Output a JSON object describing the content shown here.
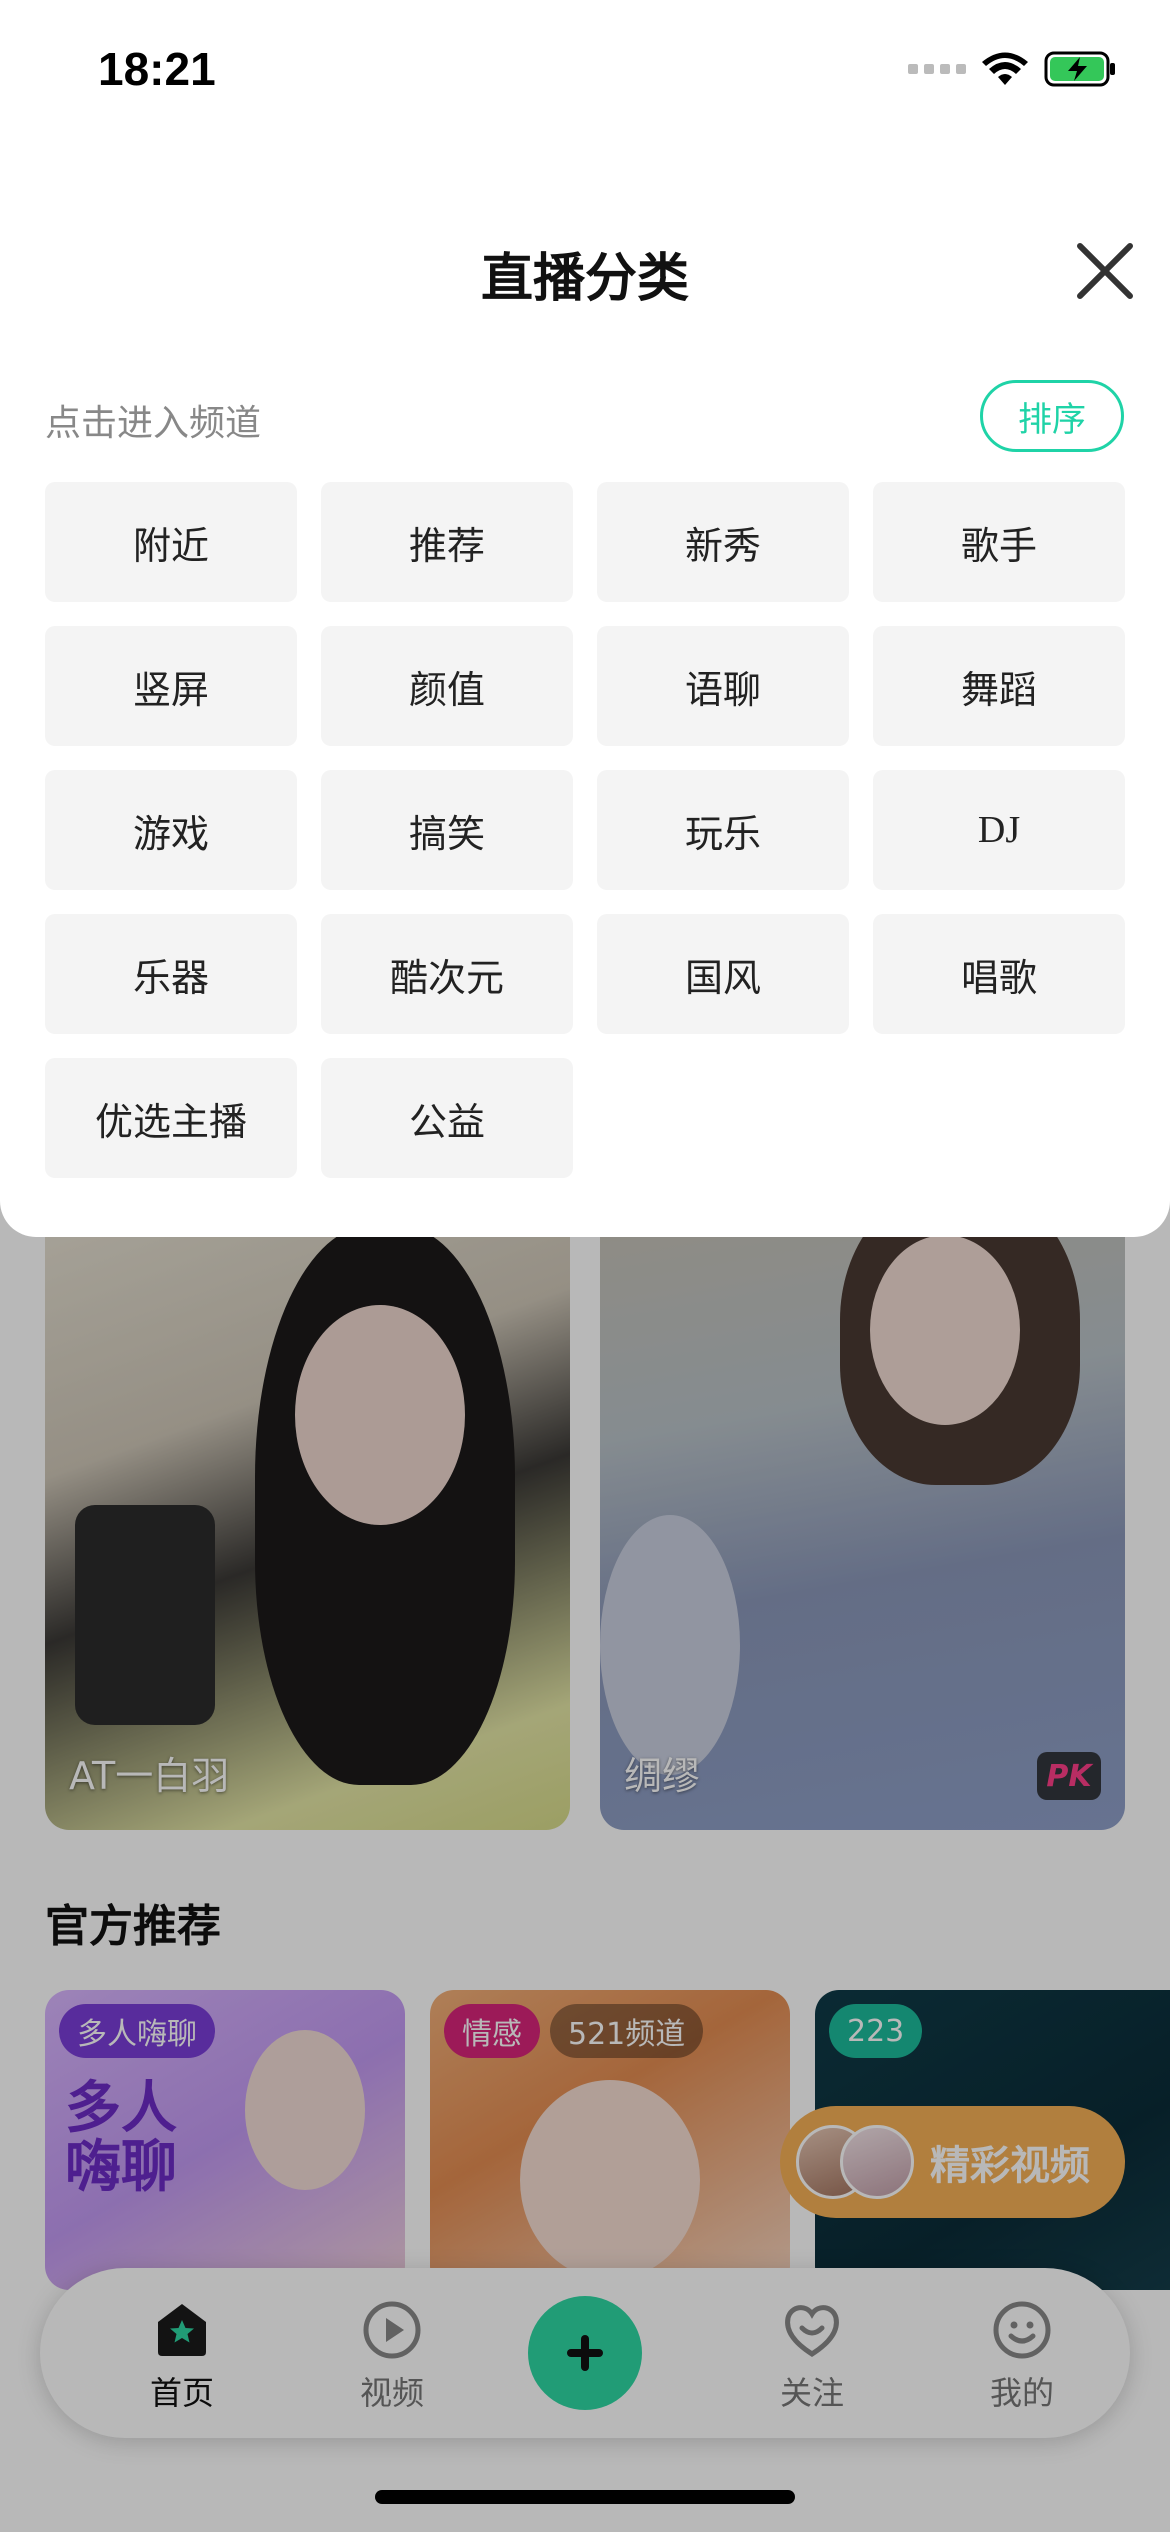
{
  "status_bar": {
    "time": "18:21"
  },
  "sheet": {
    "title": "直播分类",
    "hint": "点击进入频道",
    "sort_label": "排序",
    "channels": [
      "附近",
      "推荐",
      "新秀",
      "歌手",
      "竖屏",
      "颜值",
      "语聊",
      "舞蹈",
      "游戏",
      "搞笑",
      "玩乐",
      "DJ",
      "乐器",
      "酷次元",
      "国风",
      "唱歌",
      "优选主播",
      "公益"
    ]
  },
  "live_cards": [
    {
      "name": "AT一白羽"
    },
    {
      "name": "绸缪",
      "badge": "PK"
    }
  ],
  "section": {
    "title": "官方推荐"
  },
  "recommend_cards": [
    {
      "tag": "多人嗨聊",
      "art_text": "多人\n嗨聊"
    },
    {
      "tag": "情感",
      "extra": "521频道"
    },
    {
      "tag": "223"
    }
  ],
  "float_button": {
    "label": "精彩视频"
  },
  "tabbar": {
    "tabs": [
      {
        "label": "首页",
        "icon": "home-icon"
      },
      {
        "label": "视频",
        "icon": "play-icon"
      },
      {
        "label": "",
        "icon": "plus-icon"
      },
      {
        "label": "关注",
        "icon": "heart-icon"
      },
      {
        "label": "我的",
        "icon": "smile-icon"
      }
    ]
  },
  "colors": {
    "accent": "#1fd3a7",
    "plus": "#2fd8a4"
  }
}
